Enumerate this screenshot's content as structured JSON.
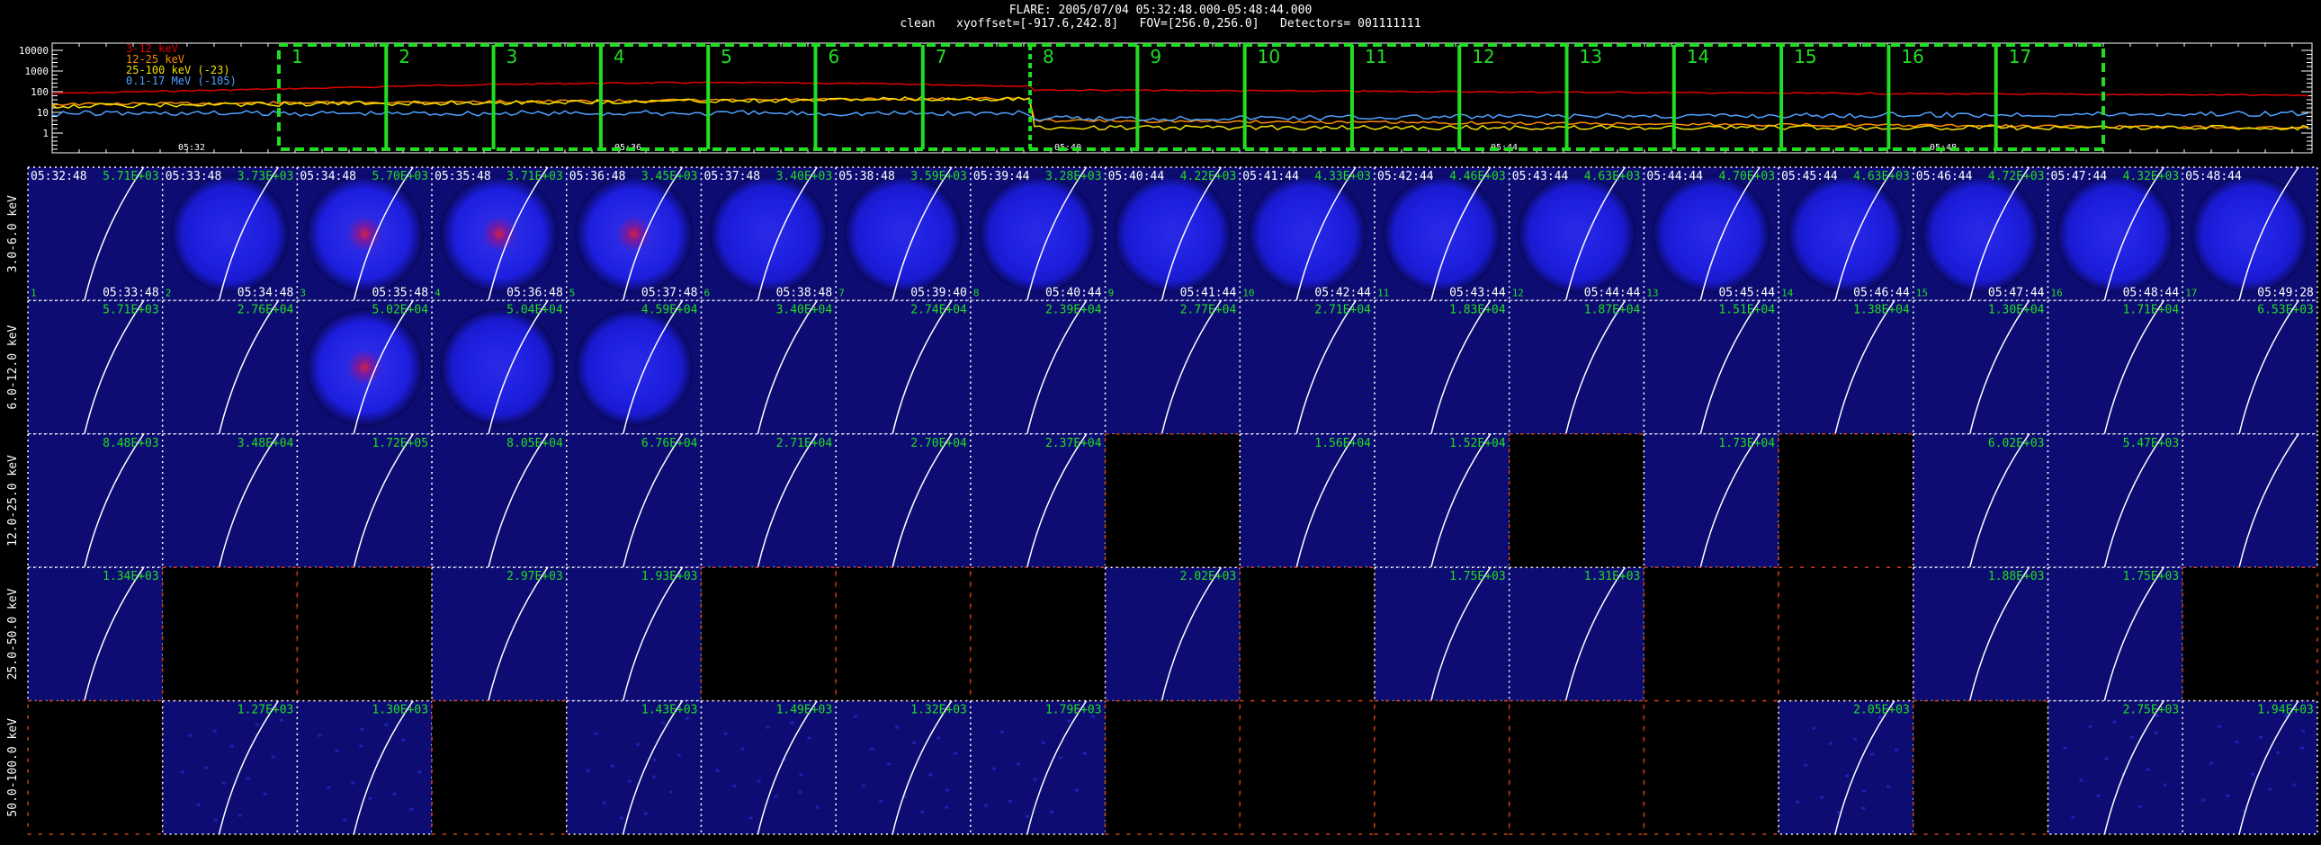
{
  "header": {
    "line1": "FLARE: 2005/07/04 05:32:48.000-05:48:44.000",
    "line2": "clean   xyoffset=[-917.6,242.8]   FOV=[256.0,256.0]   Detectors= 001111111"
  },
  "lightcurve": {
    "y_ticks": [
      "10000",
      "1000",
      "100",
      "10",
      "1"
    ],
    "x_ticks": [
      "05:32",
      "05:36",
      "05:40",
      "05:44",
      "05:48"
    ],
    "legend": [
      {
        "label": "3-12 keV",
        "color": "#e00000"
      },
      {
        "label": "12-25 keV",
        "color": "#ff8c00"
      },
      {
        "label": "25-100 keV (-23)",
        "color": "#f0e000"
      },
      {
        "label": "0.1-17 MeV (-105)",
        "color": "#4ea0ff"
      }
    ],
    "interval_numbers": [
      "1",
      "2",
      "3",
      "4",
      "5",
      "6",
      "7",
      "8",
      "9",
      "10",
      "11",
      "12",
      "13",
      "14",
      "15",
      "16",
      "17"
    ]
  },
  "grid": {
    "row_labels": [
      "3.0-6.0 keV",
      "6.0-12.0 keV",
      "12.0-25.0 keV",
      "25.0-50.0 keV",
      "50.0-100.0 keV"
    ],
    "start_times": [
      "05:32:48",
      "05:33:48",
      "05:34:48",
      "05:35:48",
      "05:36:48",
      "05:37:48",
      "05:38:48",
      "05:39:44",
      "05:40:44",
      "05:41:44",
      "05:42:44",
      "05:43:44",
      "05:44:44",
      "05:45:44",
      "05:46:44",
      "05:47:44",
      "05:48:44"
    ],
    "end_times": [
      "05:33:48",
      "05:34:48",
      "05:35:48",
      "05:36:48",
      "05:37:48",
      "05:38:48",
      "05:39:40",
      "05:40:44",
      "05:41:44",
      "05:42:44",
      "05:43:44",
      "05:44:44",
      "05:45:44",
      "05:46:44",
      "05:47:44",
      "05:48:44",
      "05:49:28"
    ],
    "rows": [
      {
        "values": [
          "5.71E+03",
          "3.73E+03",
          "5.70E+03",
          "3.71E+03",
          "3.45E+03",
          "3.40E+03",
          "3.59E+03",
          "3.28E+03",
          "4.22E+03",
          "4.33E+03",
          "4.46E+03",
          "4.63E+03",
          "4.70E+03",
          "4.63E+03",
          "4.72E+03",
          "4.32E+03",
          ""
        ],
        "kinds": [
          "faint",
          "disk",
          "diskred",
          "diskred",
          "diskred",
          "disk",
          "disk",
          "disk",
          "disk",
          "disk",
          "disk",
          "disk",
          "disk",
          "disk",
          "disk",
          "disk",
          "disk"
        ]
      },
      {
        "values": [
          "5.71E+03",
          "2.76E+04",
          "5.02E+04",
          "5.04E+04",
          "4.59E+04",
          "3.40E+04",
          "2.74E+04",
          "2.39E+04",
          "2.77E+04",
          "2.71E+04",
          "1.83E+04",
          "1.87E+04",
          "1.51E+04",
          "1.38E+04",
          "1.30E+04",
          "1.71E+04",
          "6.53E+03"
        ],
        "kinds": [
          "faint",
          "faint",
          "diskred",
          "disk",
          "disk",
          "faint",
          "faint",
          "faint",
          "faint",
          "faint",
          "faint",
          "faint",
          "faint",
          "faint",
          "faint",
          "faint",
          "faint"
        ]
      },
      {
        "values": [
          "8.48E+03",
          "3.48E+04",
          "1.72E+05",
          "8.05E+04",
          "6.76E+04",
          "2.71E+04",
          "2.70E+04",
          "2.37E+04",
          "",
          "1.56E+04",
          "1.52E+04",
          "",
          "1.73E+04",
          "",
          "6.02E+03",
          "5.47E+03",
          ""
        ],
        "kinds": [
          "faint",
          "faint",
          "faint",
          "faint",
          "faint",
          "faint",
          "faint",
          "faint",
          "black",
          "faint",
          "faint",
          "black",
          "faint",
          "black",
          "faint",
          "faint",
          "faint"
        ]
      },
      {
        "values": [
          "1.34E+03",
          "",
          "",
          "2.97E+03",
          "1.93E+03",
          "",
          "",
          "",
          "2.02E+03",
          "",
          "1.75E+03",
          "1.31E+03",
          "",
          "",
          "1.88E+03",
          "1.75E+03",
          ""
        ],
        "kinds": [
          "faint",
          "black",
          "black",
          "faint",
          "faint",
          "black",
          "black",
          "black",
          "faint",
          "black",
          "faint",
          "faint",
          "black",
          "black",
          "faint",
          "faint",
          "black"
        ]
      },
      {
        "values": [
          "",
          "1.27E+03",
          "1.30E+03",
          "",
          "1.43E+03",
          "1.49E+03",
          "1.32E+03",
          "1.79E+03",
          "",
          "",
          "",
          "",
          "",
          "2.05E+03",
          "",
          "2.75E+03",
          "1.94E+03"
        ],
        "kinds": [
          "black",
          "noisy",
          "noisy",
          "black",
          "noisy",
          "noisy",
          "noisy",
          "noisy",
          "black",
          "black",
          "black",
          "black",
          "black",
          "noisy",
          "black",
          "noisy",
          "noisy"
        ]
      }
    ]
  }
}
